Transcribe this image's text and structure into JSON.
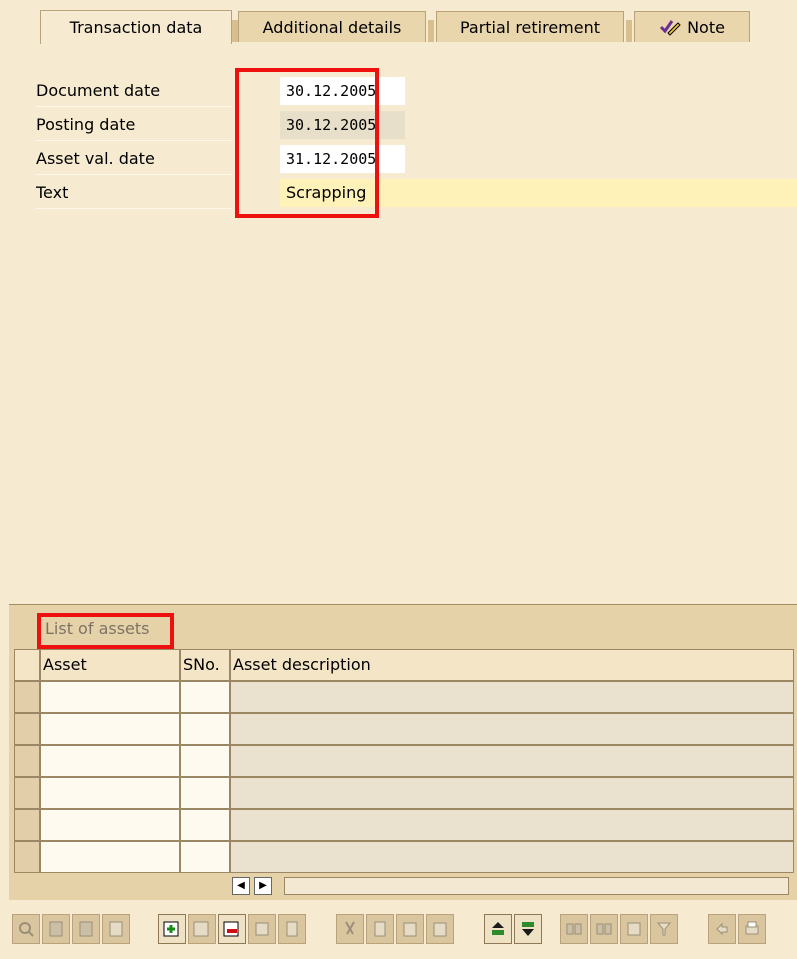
{
  "tabs": [
    {
      "label": "Transaction data",
      "active": true
    },
    {
      "label": "Additional details",
      "active": false
    },
    {
      "label": "Partial retirement",
      "active": false
    },
    {
      "label": "Note",
      "active": false,
      "icon": "pencil-note-icon"
    }
  ],
  "form": {
    "document_date": {
      "label": "Document date",
      "value": "30.12.2005"
    },
    "posting_date": {
      "label": "Posting date",
      "value": "30.12.2005"
    },
    "asset_val_date": {
      "label": "Asset val. date",
      "value": "31.12.2005"
    },
    "text": {
      "label": "Text",
      "value": "Scrapping"
    }
  },
  "assets": {
    "title": "List of assets",
    "columns": [
      "Asset",
      "SNo.",
      "Asset description"
    ],
    "rows": [
      {
        "asset": "",
        "sno": "",
        "description": ""
      },
      {
        "asset": "",
        "sno": "",
        "description": ""
      },
      {
        "asset": "",
        "sno": "",
        "description": ""
      },
      {
        "asset": "",
        "sno": "",
        "description": ""
      },
      {
        "asset": "",
        "sno": "",
        "description": ""
      },
      {
        "asset": "",
        "sno": "",
        "description": ""
      }
    ]
  },
  "toolbar": {
    "buttons": [
      "details-icon",
      "first-page-icon",
      "last-page-icon",
      "page-icon",
      "insert-row-icon",
      "append-row-icon",
      "delete-row-icon",
      "copy-row-icon",
      "copy-icon",
      "cut-icon",
      "copy-doc-icon",
      "paste-icon",
      "paste-append-icon",
      "sort-ascending-icon",
      "filter-icon",
      "find-icon",
      "find-next-icon",
      "select-icon",
      "set-filter-icon",
      "undo-icon",
      "print-icon"
    ]
  },
  "colors": {
    "background": "#f6ebd0",
    "highlight": "#ee0f0f",
    "text_field": "#fff2b8"
  }
}
